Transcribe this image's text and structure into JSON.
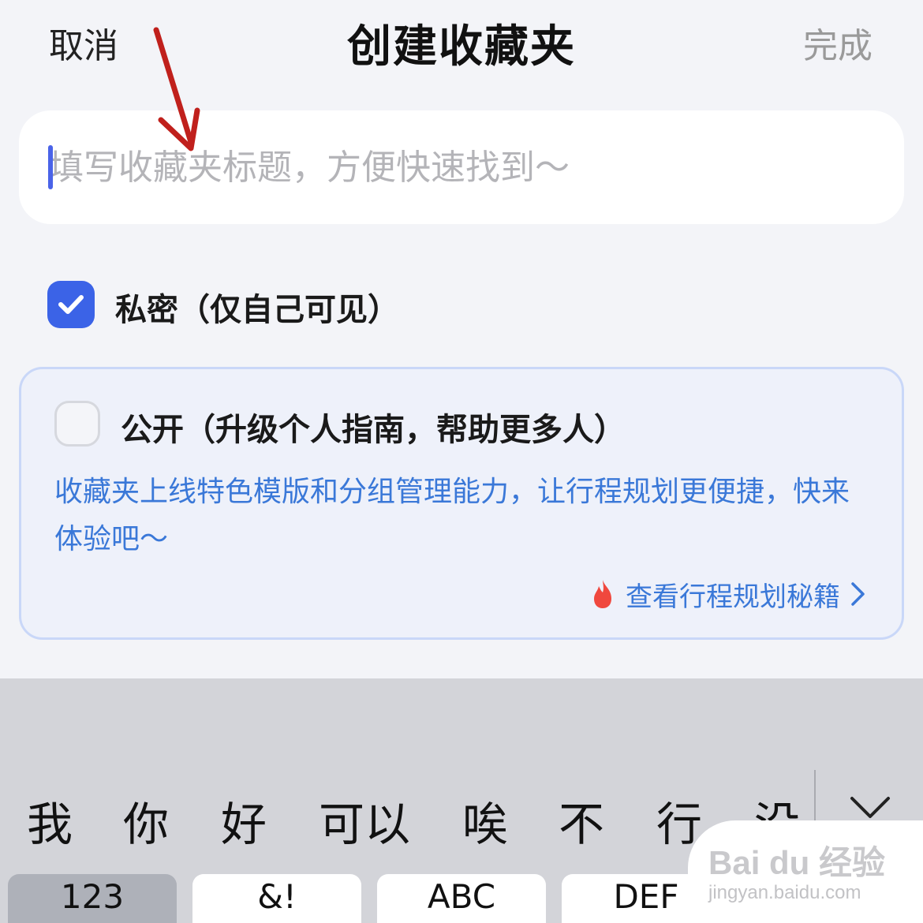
{
  "header": {
    "cancel_label": "取消",
    "title": "创建收藏夹",
    "done_label": "完成"
  },
  "title_input": {
    "placeholder": "填写收藏夹标题，方便快速找到～",
    "value": ""
  },
  "private_option": {
    "label": "私密（仅自己可见）",
    "checked": true
  },
  "public_option": {
    "label": "公开（升级个人指南，帮助更多人）",
    "checked": false,
    "description": "收藏夹上线特色模版和分组管理能力，让行程规划更便捷，快来体验吧～",
    "guide_link_label": "查看行程规划秘籍"
  },
  "keyboard": {
    "candidates": [
      "我",
      "你",
      "好",
      "可以",
      "唉",
      "不",
      "行",
      "没"
    ],
    "keys": [
      "123",
      "&!",
      "ABC",
      "DEF"
    ]
  },
  "watermark": {
    "logo": "Bai du 经验",
    "url": "jingyan.baidu.com"
  },
  "colors": {
    "accent": "#3b63e7",
    "link": "#3a78d8",
    "annotation_arrow": "#c0201c"
  }
}
